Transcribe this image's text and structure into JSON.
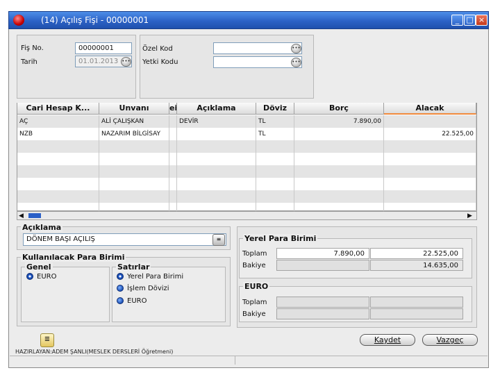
{
  "window": {
    "title": "(14) Açılış Fişi - 00000001",
    "min": "_",
    "max": "□",
    "close": "×"
  },
  "header_form": {
    "fis_no_label": "Fiş No.",
    "fis_no_value": "00000001",
    "tarih_label": "Tarih",
    "tarih_value": "01.01.2013",
    "ozel_kod_label": "Özel Kod",
    "ozel_kod_value": "",
    "yetki_kodu_label": "Yetki Kodu",
    "yetki_kodu_value": ""
  },
  "grid": {
    "columns": [
      "Cari Hesap K...",
      "Unvanı",
      "ei",
      "Açıklama",
      "Döviz",
      "Borç",
      "Alacak"
    ],
    "rows": [
      [
        "AÇ",
        "ALİ ÇALIŞKAN",
        "",
        "DEVİR",
        "TL",
        "7.890,00",
        ""
      ],
      [
        "NZB",
        "NAZARIM BİLGİSAY",
        "",
        "",
        "TL",
        "",
        "22.525,00"
      ]
    ]
  },
  "aciklama": {
    "title": "Açıklama",
    "value": "DÖNEM BAŞI AÇILIŞ"
  },
  "para_birimi": {
    "title": "Kullanılacak Para Birimi",
    "genel_title": "Genel",
    "genel_options": [
      "EURO"
    ],
    "satirlar_title": "Satırlar",
    "satirlar_options": [
      "Yerel Para Birimi",
      "İşlem Dövizi",
      "EURO"
    ]
  },
  "yerel": {
    "title": "Yerel Para Birimi",
    "toplam_label": "Toplam",
    "toplam_borc": "7.890,00",
    "toplam_alacak": "22.525,00",
    "bakiye_label": "Bakiye",
    "bakiye_borc": "",
    "bakiye_alacak": "14.635,00"
  },
  "euro": {
    "title": "EURO",
    "toplam_label": "Toplam",
    "bakiye_label": "Bakiye"
  },
  "footer": {
    "kaydet": "Kaydet",
    "vazgec": "Vazgeç",
    "credit": "HAZIRLAYAN:ADEM ŞANLI(MESLEK DERSLERİ Öğretmeni)"
  },
  "colors": {
    "title_bar": "#2c62c6",
    "radio": "#1a4fb3"
  }
}
